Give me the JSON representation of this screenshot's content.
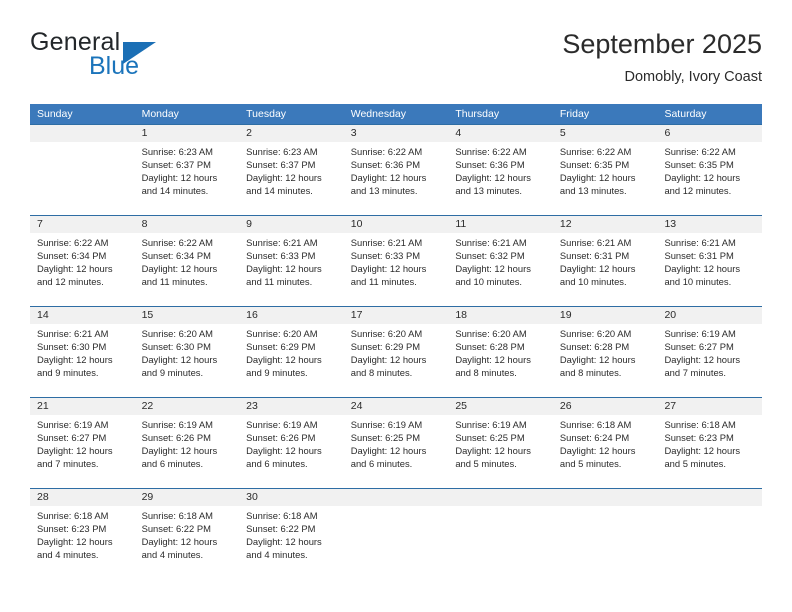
{
  "brand": {
    "name_part1": "General",
    "name_part2": "Blue"
  },
  "header": {
    "title": "September 2025",
    "subtitle": "Domobly, Ivory Coast"
  },
  "colors": {
    "header_blue": "#3b79bb",
    "rule_blue": "#2e6da4",
    "daynum_band": "#f1f1f1",
    "logo_blue": "#1b74bb",
    "text": "#2b2b2b"
  },
  "weekdays": [
    "Sunday",
    "Monday",
    "Tuesday",
    "Wednesday",
    "Thursday",
    "Friday",
    "Saturday"
  ],
  "labels": {
    "sunrise_prefix": "Sunrise:",
    "sunset_prefix": "Sunset:",
    "daylight_prefix": "Daylight:"
  },
  "weeks": [
    {
      "days": [
        {
          "num": "",
          "sunrise": "",
          "sunset": "",
          "daylight": ""
        },
        {
          "num": "1",
          "sunrise": "Sunrise: 6:23 AM",
          "sunset": "Sunset: 6:37 PM",
          "daylight": "Daylight: 12 hours and 14 minutes."
        },
        {
          "num": "2",
          "sunrise": "Sunrise: 6:23 AM",
          "sunset": "Sunset: 6:37 PM",
          "daylight": "Daylight: 12 hours and 14 minutes."
        },
        {
          "num": "3",
          "sunrise": "Sunrise: 6:22 AM",
          "sunset": "Sunset: 6:36 PM",
          "daylight": "Daylight: 12 hours and 13 minutes."
        },
        {
          "num": "4",
          "sunrise": "Sunrise: 6:22 AM",
          "sunset": "Sunset: 6:36 PM",
          "daylight": "Daylight: 12 hours and 13 minutes."
        },
        {
          "num": "5",
          "sunrise": "Sunrise: 6:22 AM",
          "sunset": "Sunset: 6:35 PM",
          "daylight": "Daylight: 12 hours and 13 minutes."
        },
        {
          "num": "6",
          "sunrise": "Sunrise: 6:22 AM",
          "sunset": "Sunset: 6:35 PM",
          "daylight": "Daylight: 12 hours and 12 minutes."
        }
      ]
    },
    {
      "days": [
        {
          "num": "7",
          "sunrise": "Sunrise: 6:22 AM",
          "sunset": "Sunset: 6:34 PM",
          "daylight": "Daylight: 12 hours and 12 minutes."
        },
        {
          "num": "8",
          "sunrise": "Sunrise: 6:22 AM",
          "sunset": "Sunset: 6:34 PM",
          "daylight": "Daylight: 12 hours and 11 minutes."
        },
        {
          "num": "9",
          "sunrise": "Sunrise: 6:21 AM",
          "sunset": "Sunset: 6:33 PM",
          "daylight": "Daylight: 12 hours and 11 minutes."
        },
        {
          "num": "10",
          "sunrise": "Sunrise: 6:21 AM",
          "sunset": "Sunset: 6:33 PM",
          "daylight": "Daylight: 12 hours and 11 minutes."
        },
        {
          "num": "11",
          "sunrise": "Sunrise: 6:21 AM",
          "sunset": "Sunset: 6:32 PM",
          "daylight": "Daylight: 12 hours and 10 minutes."
        },
        {
          "num": "12",
          "sunrise": "Sunrise: 6:21 AM",
          "sunset": "Sunset: 6:31 PM",
          "daylight": "Daylight: 12 hours and 10 minutes."
        },
        {
          "num": "13",
          "sunrise": "Sunrise: 6:21 AM",
          "sunset": "Sunset: 6:31 PM",
          "daylight": "Daylight: 12 hours and 10 minutes."
        }
      ]
    },
    {
      "days": [
        {
          "num": "14",
          "sunrise": "Sunrise: 6:21 AM",
          "sunset": "Sunset: 6:30 PM",
          "daylight": "Daylight: 12 hours and 9 minutes."
        },
        {
          "num": "15",
          "sunrise": "Sunrise: 6:20 AM",
          "sunset": "Sunset: 6:30 PM",
          "daylight": "Daylight: 12 hours and 9 minutes."
        },
        {
          "num": "16",
          "sunrise": "Sunrise: 6:20 AM",
          "sunset": "Sunset: 6:29 PM",
          "daylight": "Daylight: 12 hours and 9 minutes."
        },
        {
          "num": "17",
          "sunrise": "Sunrise: 6:20 AM",
          "sunset": "Sunset: 6:29 PM",
          "daylight": "Daylight: 12 hours and 8 minutes."
        },
        {
          "num": "18",
          "sunrise": "Sunrise: 6:20 AM",
          "sunset": "Sunset: 6:28 PM",
          "daylight": "Daylight: 12 hours and 8 minutes."
        },
        {
          "num": "19",
          "sunrise": "Sunrise: 6:20 AM",
          "sunset": "Sunset: 6:28 PM",
          "daylight": "Daylight: 12 hours and 8 minutes."
        },
        {
          "num": "20",
          "sunrise": "Sunrise: 6:19 AM",
          "sunset": "Sunset: 6:27 PM",
          "daylight": "Daylight: 12 hours and 7 minutes."
        }
      ]
    },
    {
      "days": [
        {
          "num": "21",
          "sunrise": "Sunrise: 6:19 AM",
          "sunset": "Sunset: 6:27 PM",
          "daylight": "Daylight: 12 hours and 7 minutes."
        },
        {
          "num": "22",
          "sunrise": "Sunrise: 6:19 AM",
          "sunset": "Sunset: 6:26 PM",
          "daylight": "Daylight: 12 hours and 6 minutes."
        },
        {
          "num": "23",
          "sunrise": "Sunrise: 6:19 AM",
          "sunset": "Sunset: 6:26 PM",
          "daylight": "Daylight: 12 hours and 6 minutes."
        },
        {
          "num": "24",
          "sunrise": "Sunrise: 6:19 AM",
          "sunset": "Sunset: 6:25 PM",
          "daylight": "Daylight: 12 hours and 6 minutes."
        },
        {
          "num": "25",
          "sunrise": "Sunrise: 6:19 AM",
          "sunset": "Sunset: 6:25 PM",
          "daylight": "Daylight: 12 hours and 5 minutes."
        },
        {
          "num": "26",
          "sunrise": "Sunrise: 6:18 AM",
          "sunset": "Sunset: 6:24 PM",
          "daylight": "Daylight: 12 hours and 5 minutes."
        },
        {
          "num": "27",
          "sunrise": "Sunrise: 6:18 AM",
          "sunset": "Sunset: 6:23 PM",
          "daylight": "Daylight: 12 hours and 5 minutes."
        }
      ]
    },
    {
      "days": [
        {
          "num": "28",
          "sunrise": "Sunrise: 6:18 AM",
          "sunset": "Sunset: 6:23 PM",
          "daylight": "Daylight: 12 hours and 4 minutes."
        },
        {
          "num": "29",
          "sunrise": "Sunrise: 6:18 AM",
          "sunset": "Sunset: 6:22 PM",
          "daylight": "Daylight: 12 hours and 4 minutes."
        },
        {
          "num": "30",
          "sunrise": "Sunrise: 6:18 AM",
          "sunset": "Sunset: 6:22 PM",
          "daylight": "Daylight: 12 hours and 4 minutes."
        },
        {
          "num": "",
          "sunrise": "",
          "sunset": "",
          "daylight": ""
        },
        {
          "num": "",
          "sunrise": "",
          "sunset": "",
          "daylight": ""
        },
        {
          "num": "",
          "sunrise": "",
          "sunset": "",
          "daylight": ""
        },
        {
          "num": "",
          "sunrise": "",
          "sunset": "",
          "daylight": ""
        }
      ]
    }
  ]
}
